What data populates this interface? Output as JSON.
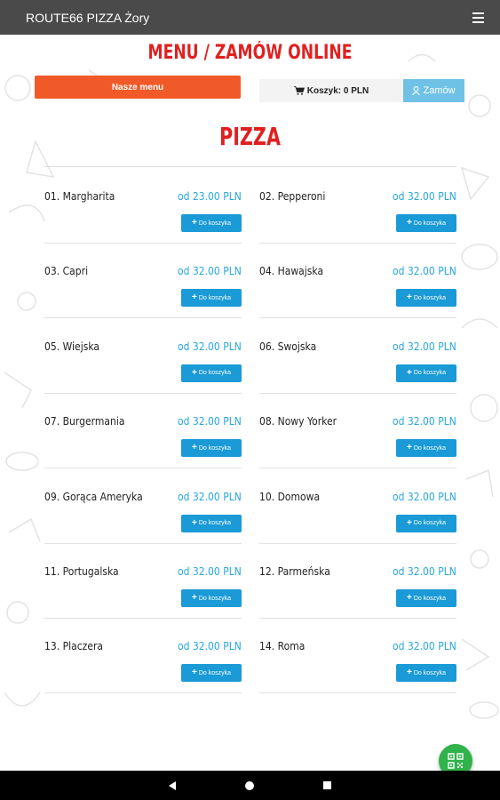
{
  "appbar": {
    "title": "ROUTE66 PIZZA Żory"
  },
  "page": {
    "heading": "MENU / ZAMÓW ONLINE",
    "menu_button": "Nasze menu",
    "cart_label": "Koszyk: 0 PLN",
    "order_button": "Zamów",
    "section_title": "PIZZA"
  },
  "add_label": "Do koszyka",
  "items": [
    {
      "name": "01. Margharita",
      "price": "od 23.00 PLN"
    },
    {
      "name": "02. Pepperoni",
      "price": "od 32.00 PLN"
    },
    {
      "name": "03. Capri",
      "price": "od 32.00 PLN"
    },
    {
      "name": "04. Hawajska",
      "price": "od 32.00 PLN"
    },
    {
      "name": "05. Wiejska",
      "price": "od 32.00 PLN"
    },
    {
      "name": "06. Swojska",
      "price": "od 32.00 PLN"
    },
    {
      "name": "07. Burgermania",
      "price": "od 32.00 PLN"
    },
    {
      "name": "08. Nowy Yorker",
      "price": "od 32.00 PLN"
    },
    {
      "name": "09. Gorąca Ameryka",
      "price": "od 32.00 PLN"
    },
    {
      "name": "10. Domowa",
      "price": "od 32.00 PLN"
    },
    {
      "name": "11. Portugalska",
      "price": "od 32.00 PLN"
    },
    {
      "name": "12. Parmeńska",
      "price": "od 32.00 PLN"
    },
    {
      "name": "13. Placzera",
      "price": "od 32.00 PLN"
    },
    {
      "name": "14. Roma",
      "price": "od 32.00 PLN"
    }
  ],
  "colors": {
    "appbar": "#4a4a4a",
    "heading_red": "#e02020",
    "menu_orange": "#f05a28",
    "price_blue": "#29a7df",
    "button_blue": "#1a9ad6",
    "order_lightblue": "#6fc2e6",
    "fab_green": "#2fb34a"
  },
  "icons": {
    "menu": "hamburger-menu-icon",
    "cart": "shopping-cart-icon",
    "order": "user-icon",
    "add": "plus-icon",
    "fab": "qr-code-icon",
    "nav": [
      "back-triangle-icon",
      "home-circle-icon",
      "recents-square-icon"
    ]
  }
}
